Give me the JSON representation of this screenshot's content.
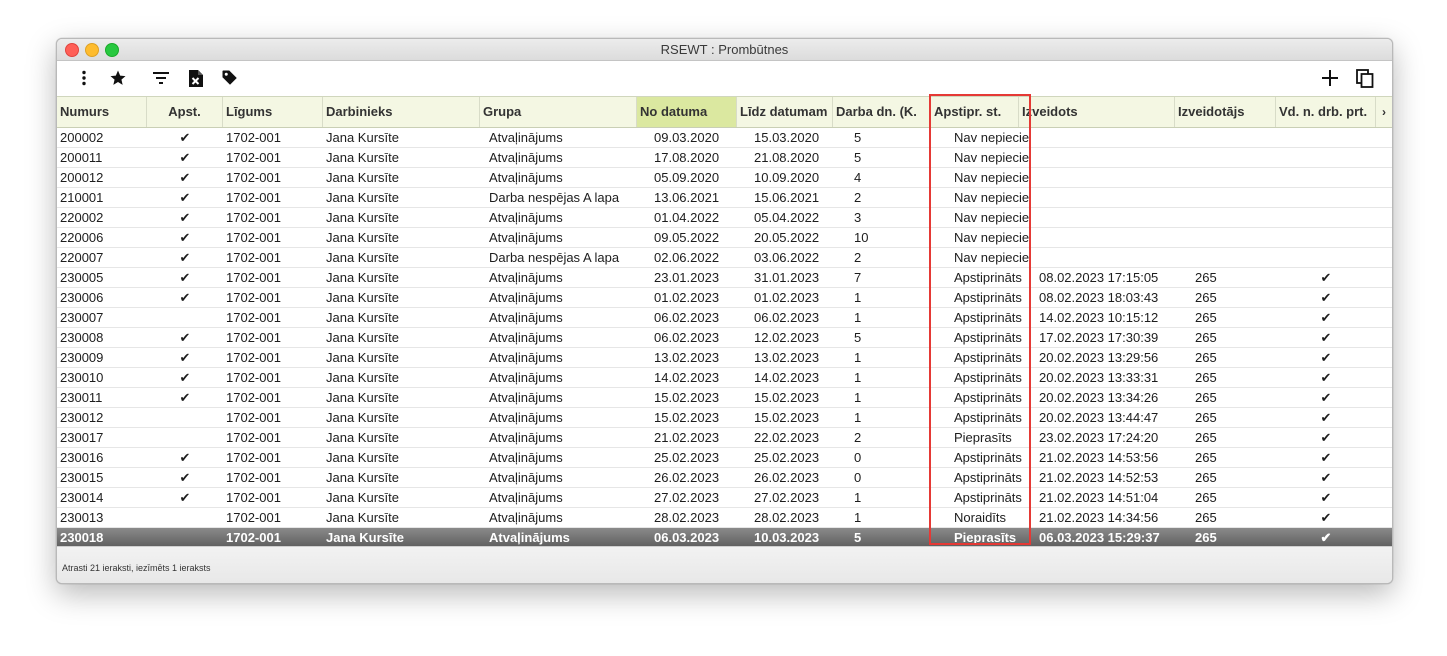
{
  "window": {
    "title": "RSEWT : Prombūtnes"
  },
  "toolbar": {
    "left_icons": [
      "more-vertical-icon",
      "star-icon",
      "filter-icon",
      "excel-export-icon",
      "tag-icon"
    ],
    "right_icons": [
      "add-icon",
      "copy-icon"
    ]
  },
  "table": {
    "columns": [
      "Numurs",
      "Apst.",
      "Līgums",
      "Darbinieks",
      "Grupa",
      "No datuma",
      "Līdz datumam",
      "Darba dn. (K.",
      "Apstipr. st.",
      "Izveidots",
      "Izveidotājs",
      "Vd. n. drb. prt."
    ],
    "sorted_column": "No datuma",
    "scroll_right_glyph": "›",
    "rows": [
      [
        "200002",
        "✔",
        "1702-001",
        "Jana Kursīte",
        "Atvaļinājums",
        "09.03.2020",
        "15.03.2020",
        "5",
        "Nav nepiecieš",
        "",
        "",
        ""
      ],
      [
        "200011",
        "✔",
        "1702-001",
        "Jana Kursīte",
        "Atvaļinājums",
        "17.08.2020",
        "21.08.2020",
        "5",
        "Nav nepiecieš",
        "",
        "",
        ""
      ],
      [
        "200012",
        "✔",
        "1702-001",
        "Jana Kursīte",
        "Atvaļinājums",
        "05.09.2020",
        "10.09.2020",
        "4",
        "Nav nepiecieš",
        "",
        "",
        ""
      ],
      [
        "210001",
        "✔",
        "1702-001",
        "Jana Kursīte",
        "Darba nespējas A lapa",
        "13.06.2021",
        "15.06.2021",
        "2",
        "Nav nepiecieš",
        "",
        "",
        ""
      ],
      [
        "220002",
        "✔",
        "1702-001",
        "Jana Kursīte",
        "Atvaļinājums",
        "01.04.2022",
        "05.04.2022",
        "3",
        "Nav nepiecieš",
        "",
        "",
        ""
      ],
      [
        "220006",
        "✔",
        "1702-001",
        "Jana Kursīte",
        "Atvaļinājums",
        "09.05.2022",
        "20.05.2022",
        "10",
        "Nav nepiecieš",
        "",
        "",
        ""
      ],
      [
        "220007",
        "✔",
        "1702-001",
        "Jana Kursīte",
        "Darba nespējas A lapa",
        "02.06.2022",
        "03.06.2022",
        "2",
        "Nav nepiecieš",
        "",
        "",
        ""
      ],
      [
        "230005",
        "✔",
        "1702-001",
        "Jana Kursīte",
        "Atvaļinājums",
        "23.01.2023",
        "31.01.2023",
        "7",
        "Apstiprināts",
        "08.02.2023 17:15:05",
        "265",
        "✔"
      ],
      [
        "230006",
        "✔",
        "1702-001",
        "Jana Kursīte",
        "Atvaļinājums",
        "01.02.2023",
        "01.02.2023",
        "1",
        "Apstiprināts",
        "08.02.2023 18:03:43",
        "265",
        "✔"
      ],
      [
        "230007",
        "",
        "1702-001",
        "Jana Kursīte",
        "Atvaļinājums",
        "06.02.2023",
        "06.02.2023",
        "1",
        "Apstiprināts",
        "14.02.2023 10:15:12",
        "265",
        "✔"
      ],
      [
        "230008",
        "✔",
        "1702-001",
        "Jana Kursīte",
        "Atvaļinājums",
        "06.02.2023",
        "12.02.2023",
        "5",
        "Apstiprināts",
        "17.02.2023 17:30:39",
        "265",
        "✔"
      ],
      [
        "230009",
        "✔",
        "1702-001",
        "Jana Kursīte",
        "Atvaļinājums",
        "13.02.2023",
        "13.02.2023",
        "1",
        "Apstiprināts",
        "20.02.2023 13:29:56",
        "265",
        "✔"
      ],
      [
        "230010",
        "✔",
        "1702-001",
        "Jana Kursīte",
        "Atvaļinājums",
        "14.02.2023",
        "14.02.2023",
        "1",
        "Apstiprināts",
        "20.02.2023 13:33:31",
        "265",
        "✔"
      ],
      [
        "230011",
        "✔",
        "1702-001",
        "Jana Kursīte",
        "Atvaļinājums",
        "15.02.2023",
        "15.02.2023",
        "1",
        "Apstiprināts",
        "20.02.2023 13:34:26",
        "265",
        "✔"
      ],
      [
        "230012",
        "",
        "1702-001",
        "Jana Kursīte",
        "Atvaļinājums",
        "15.02.2023",
        "15.02.2023",
        "1",
        "Apstiprināts",
        "20.02.2023 13:44:47",
        "265",
        "✔"
      ],
      [
        "230017",
        "",
        "1702-001",
        "Jana Kursīte",
        "Atvaļinājums",
        "21.02.2023",
        "22.02.2023",
        "2",
        "Pieprasīts",
        "23.02.2023 17:24:20",
        "265",
        "✔"
      ],
      [
        "230016",
        "✔",
        "1702-001",
        "Jana Kursīte",
        "Atvaļinājums",
        "25.02.2023",
        "25.02.2023",
        "0",
        "Apstiprināts",
        "21.02.2023 14:53:56",
        "265",
        "✔"
      ],
      [
        "230015",
        "✔",
        "1702-001",
        "Jana Kursīte",
        "Atvaļinājums",
        "26.02.2023",
        "26.02.2023",
        "0",
        "Apstiprināts",
        "21.02.2023 14:52:53",
        "265",
        "✔"
      ],
      [
        "230014",
        "✔",
        "1702-001",
        "Jana Kursīte",
        "Atvaļinājums",
        "27.02.2023",
        "27.02.2023",
        "1",
        "Apstiprināts",
        "21.02.2023 14:51:04",
        "265",
        "✔"
      ],
      [
        "230013",
        "",
        "1702-001",
        "Jana Kursīte",
        "Atvaļinājums",
        "28.02.2023",
        "28.02.2023",
        "1",
        "Noraidīts",
        "21.02.2023 14:34:56",
        "265",
        "✔"
      ],
      [
        "230018",
        "",
        "1702-001",
        "Jana Kursīte",
        "Atvaļinājums",
        "06.03.2023",
        "10.03.2023",
        "5",
        "Pieprasīts",
        "06.03.2023 15:29:37",
        "265",
        "✔"
      ]
    ],
    "selected_row_index": 20
  },
  "status": {
    "text": "Atrasti 21 ieraksti, iezīmēts 1 ieraksts"
  },
  "colors": {
    "header_bg": "#f4f7e3",
    "sorted_header_bg": "#dbe8a0",
    "selected_row": "#6e6e6e",
    "highlight_border": "#e53935"
  }
}
